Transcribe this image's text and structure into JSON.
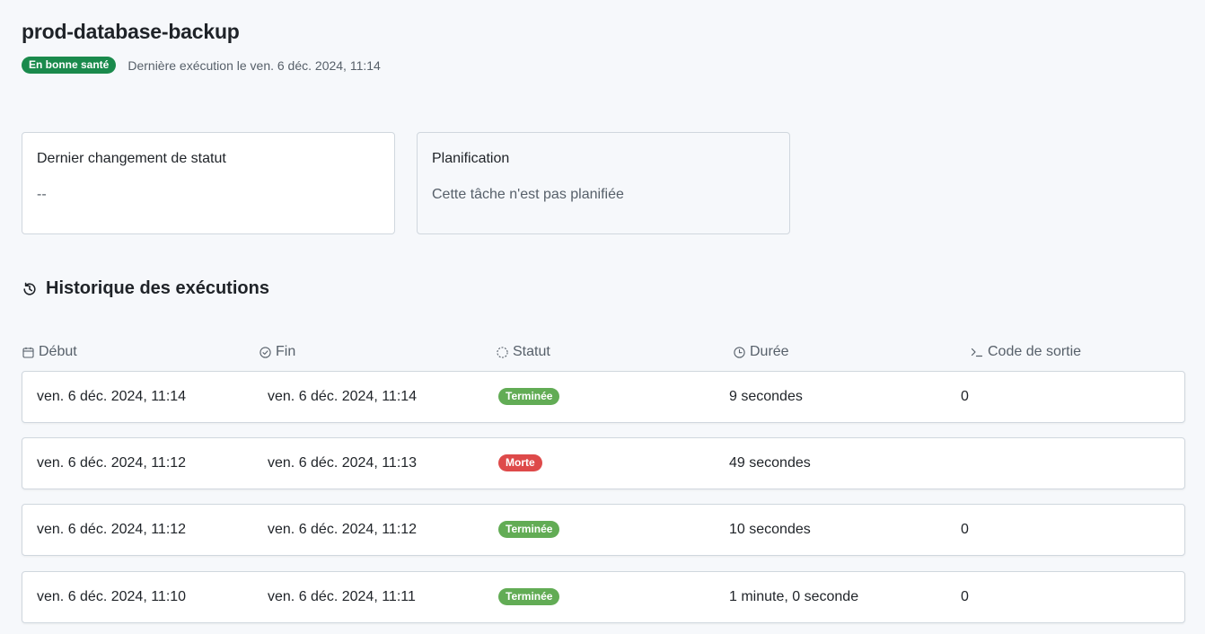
{
  "job": {
    "name": "prod-database-backup",
    "health_badge": "En bonne santé",
    "last_run": "Dernière exécution le ven. 6 déc. 2024, 11:14"
  },
  "cards": {
    "status_change": {
      "title": "Dernier changement de statut",
      "value": "--"
    },
    "schedule": {
      "title": "Planification",
      "value": "Cette tâche n'est pas planifiée"
    }
  },
  "history": {
    "title": "Historique des exécutions",
    "columns": {
      "start": "Début",
      "end": "Fin",
      "status": "Statut",
      "duration": "Durée",
      "exit_code": "Code de sortie"
    },
    "rows": [
      {
        "start": "ven. 6 déc. 2024, 11:14",
        "end": "ven. 6 déc. 2024, 11:14",
        "status": "Terminée",
        "duration": "9 secondes",
        "exit_code": "0"
      },
      {
        "start": "ven. 6 déc. 2024, 11:12",
        "end": "ven. 6 déc. 2024, 11:13",
        "status": "Morte",
        "duration": "49 secondes",
        "exit_code": ""
      },
      {
        "start": "ven. 6 déc. 2024, 11:12",
        "end": "ven. 6 déc. 2024, 11:12",
        "status": "Terminée",
        "duration": "10 secondes",
        "exit_code": "0"
      },
      {
        "start": "ven. 6 déc. 2024, 11:10",
        "end": "ven. 6 déc. 2024, 11:11",
        "status": "Terminée",
        "duration": "1 minute, 0 seconde",
        "exit_code": "0"
      }
    ]
  },
  "colors": {
    "healthy": "#1a8a4c",
    "done": "#62ac55",
    "dead": "#de4a4a"
  },
  "icons": {
    "history": "history-icon",
    "start": "calendar-icon",
    "end": "check-circle-icon",
    "status": "dashed-circle-icon",
    "duration": "clock-icon",
    "exit_code": "terminal-icon"
  }
}
